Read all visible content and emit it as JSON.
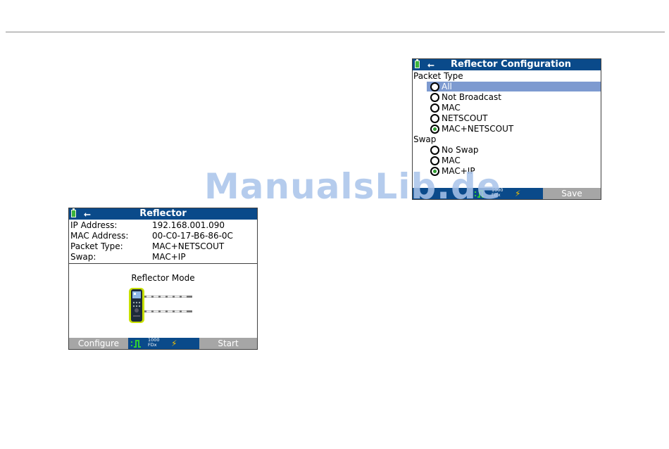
{
  "reflector": {
    "title": "Reflector",
    "fields": [
      {
        "label": "IP Address:",
        "value": "192.168.001.090"
      },
      {
        "label": "MAC Address:",
        "value": "00-C0-17-B6-86-0C"
      },
      {
        "label": "Packet Type:",
        "value": "MAC+NETSCOUT"
      },
      {
        "label": "Swap:",
        "value": "MAC+IP"
      }
    ],
    "mode_label": "Reflector Mode",
    "softkeys": {
      "left": "Configure",
      "right": "Start"
    },
    "link_speed": "1000",
    "link_duplex": "FDx"
  },
  "config": {
    "title": "Reflector Configuration",
    "packet_type_heading": "Packet Type",
    "packet_type_options": [
      "All",
      "Not Broadcast",
      "MAC",
      "NETSCOUT",
      "MAC+NETSCOUT"
    ],
    "packet_type_selected": 4,
    "packet_type_highlighted": 0,
    "swap_heading": "Swap",
    "swap_options": [
      "No Swap",
      "MAC",
      "MAC+IP"
    ],
    "swap_selected": 2,
    "softkeys": {
      "right": "Save"
    },
    "link_speed": "1000",
    "link_duplex": "FDx"
  },
  "watermark": "ManualsLib.de",
  "icons": [
    "battery-icon",
    "usb-icon",
    "link-pulse-icon",
    "bolt-icon",
    "tester-device-icon"
  ],
  "colors": {
    "titlebar": "#0a4a8a",
    "highlight": "#7d9ad0",
    "softkey": "#a6a6a6",
    "selected_radio": "#2e9b2e",
    "link": "#33cc33",
    "bolt": "#f5c000"
  }
}
